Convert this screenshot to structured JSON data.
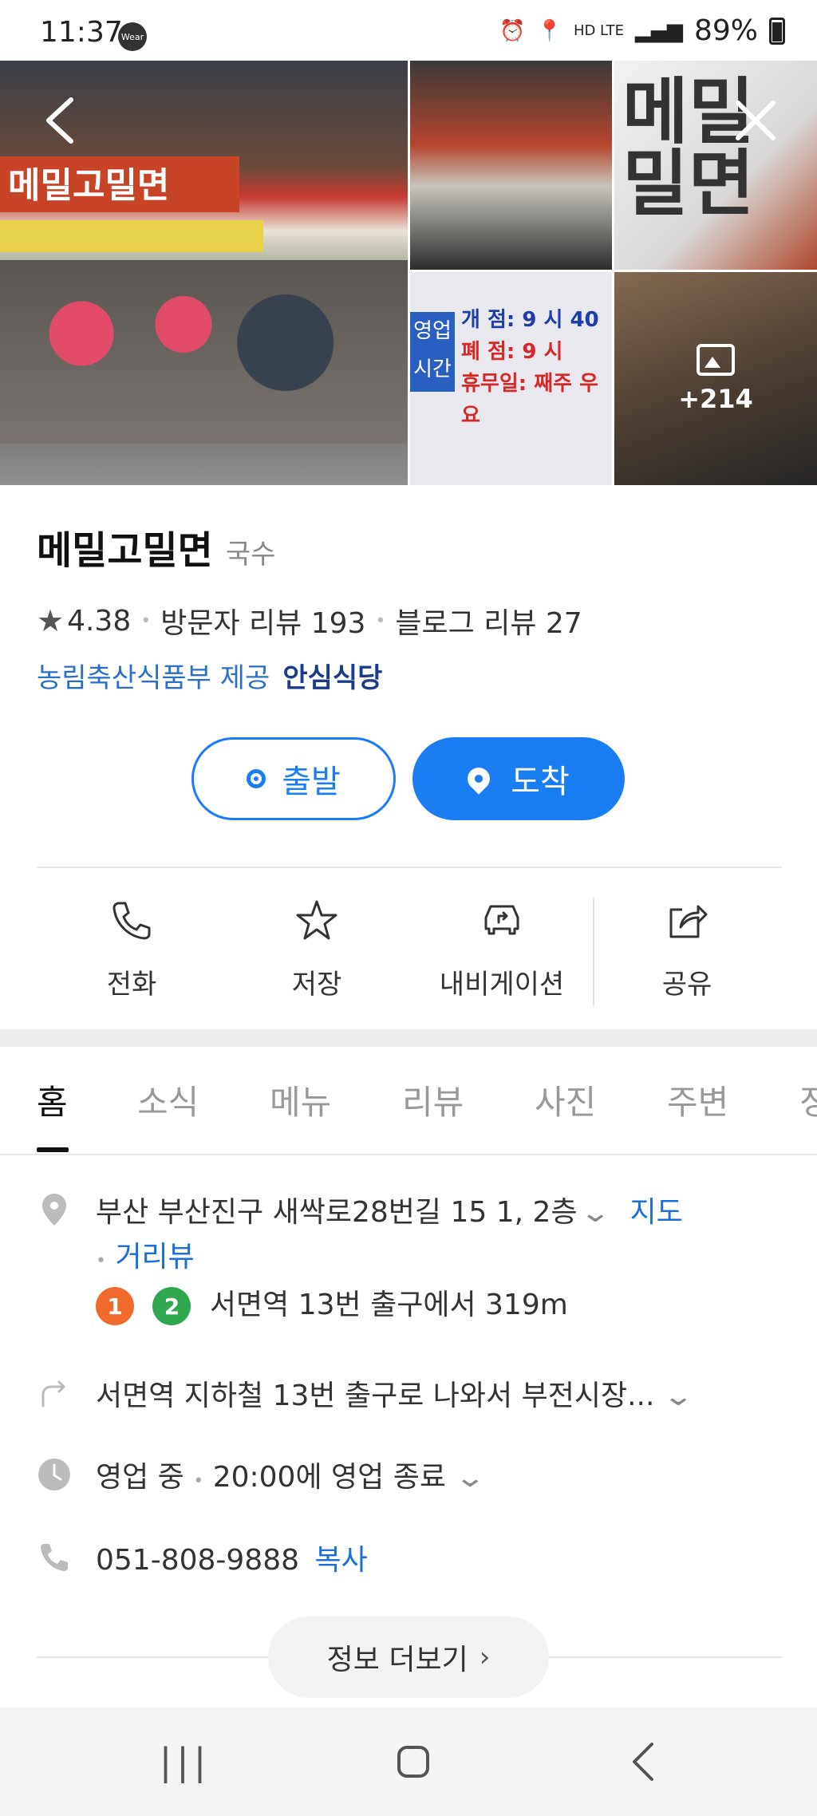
{
  "status_bar": {
    "time": "11:37",
    "wear_label": "Wear",
    "network": "HD LTE",
    "battery": "89%"
  },
  "gallery": {
    "photo_texts": {
      "store_sign": "메밀고밀면",
      "hours_tag": "영업\n시간",
      "hours_lines": [
        "개 점: 9 시 40",
        "폐 점: 9 시",
        "휴무일: 째주 우요"
      ],
      "sign_big": "메밀\n밀면"
    },
    "more_count": "+214"
  },
  "place": {
    "name": "메밀고밀면",
    "category": "국수",
    "rating": "4.38",
    "visitor_reviews": "방문자 리뷰 193",
    "blog_reviews": "블로그 리뷰 27",
    "provider": "농림축산식품부 제공",
    "safe_label": "안심식당"
  },
  "route_buttons": {
    "start": "출발",
    "arrive": "도착"
  },
  "actions": [
    {
      "label": "전화",
      "icon": "phone-icon"
    },
    {
      "label": "저장",
      "icon": "star-icon"
    },
    {
      "label": "내비게이션",
      "icon": "car-icon"
    },
    {
      "label": "공유",
      "icon": "share-icon"
    }
  ],
  "tabs": [
    "홈",
    "소식",
    "메뉴",
    "리뷰",
    "사진",
    "주변",
    "정"
  ],
  "info": {
    "address": "부산 부산진구 새싹로28번길 15 1, 2층",
    "map_link": "지도",
    "street_view": "거리뷰",
    "subway_line1": "1",
    "subway_line2": "2",
    "subway_text": "서면역 13번 출구에서 319m",
    "directions": "서면역 지하철 13번 출구로 나와서 부전시장...",
    "hours_status": "영업 중",
    "hours_detail": "20:00에 영업 종료",
    "phone": "051-808-9888",
    "copy": "복사"
  },
  "more_info_button": "정보 더보기",
  "colors": {
    "accent": "#1a7ef2",
    "link": "#1a6fd8",
    "line1": "#f06a2d",
    "line2": "#2fa84f"
  }
}
